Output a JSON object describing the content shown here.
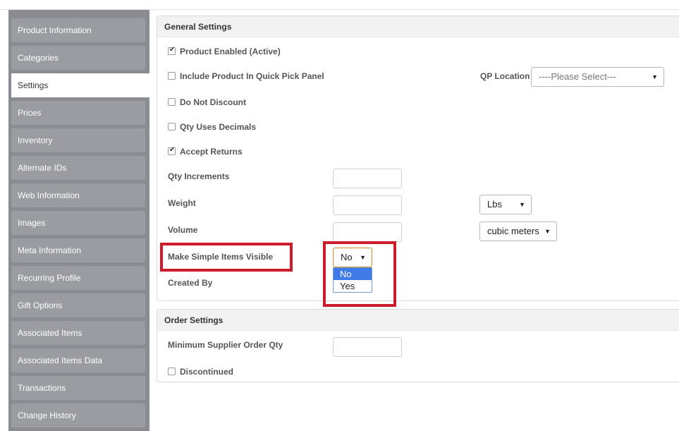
{
  "sidebar": {
    "items": [
      {
        "label": "Product Information"
      },
      {
        "label": "Categories"
      },
      {
        "label": "Settings"
      },
      {
        "label": "Prices"
      },
      {
        "label": "Inventory"
      },
      {
        "label": "Alternate IDs"
      },
      {
        "label": "Web Information"
      },
      {
        "label": "Images"
      },
      {
        "label": "Meta Information"
      },
      {
        "label": "Recurring Profile"
      },
      {
        "label": "Gift Options"
      },
      {
        "label": "Associated Items"
      },
      {
        "label": "Associated Items Data"
      },
      {
        "label": "Transactions"
      },
      {
        "label": "Change History"
      }
    ],
    "active_index": 2
  },
  "general": {
    "title": "General Settings",
    "product_enabled": {
      "label": "Product Enabled (Active)",
      "checked": true
    },
    "quick_pick": {
      "label": "Include Product In Quick Pick Panel",
      "checked": false
    },
    "qp_location": {
      "label": "QP Location",
      "placeholder": "----Please Select---"
    },
    "do_not_discount": {
      "label": "Do Not Discount",
      "checked": false
    },
    "qty_decimals": {
      "label": "Qty Uses Decimals",
      "checked": false
    },
    "accept_returns": {
      "label": "Accept Returns",
      "checked": true
    },
    "qty_increments": {
      "label": "Qty Increments",
      "value": ""
    },
    "weight": {
      "label": "Weight",
      "value": "",
      "unit": "Lbs"
    },
    "volume": {
      "label": "Volume",
      "value": "",
      "unit": "cubic meters"
    },
    "simple_items_visible": {
      "label": "Make Simple Items Visible",
      "value": "No",
      "options": [
        "No",
        "Yes"
      ],
      "highlighted": "No"
    },
    "created_by": {
      "label": "Created By"
    }
  },
  "order": {
    "title": "Order Settings",
    "min_supplier_qty": {
      "label": "Minimum Supplier Order Qty",
      "value": ""
    },
    "discontinued": {
      "label": "Discontinued",
      "checked": false
    }
  },
  "colors": {
    "sidebar_bg": "#8a8c92",
    "highlight_red": "#cc1b2b",
    "option_selected": "#3e7be8"
  }
}
